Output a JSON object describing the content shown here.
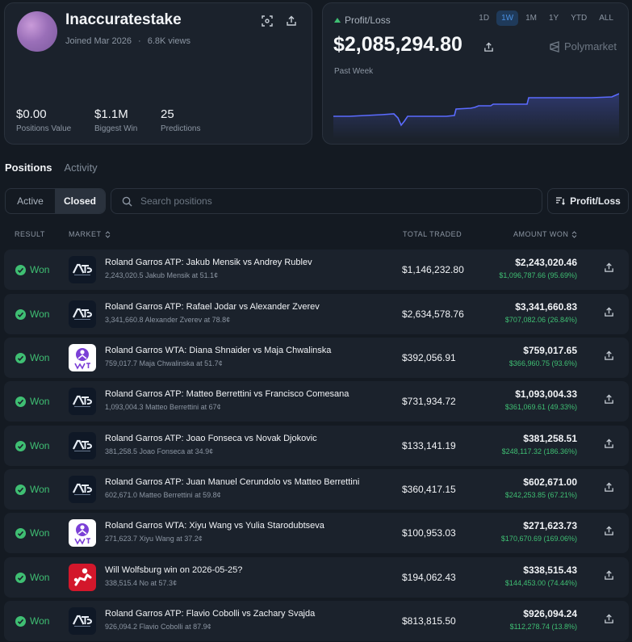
{
  "profile": {
    "username": "Inaccuratestake",
    "joined": "Joined Mar 2026",
    "separator": "·",
    "views": "6.8K views",
    "stats": [
      {
        "value": "$0.00",
        "label": "Positions Value"
      },
      {
        "value": "$1.1M",
        "label": "Biggest Win"
      },
      {
        "value": "25",
        "label": "Predictions"
      }
    ]
  },
  "pnl": {
    "label": "Profit/Loss",
    "value": "$2,085,294.80",
    "brand": "Polymarket",
    "period_label": "Past Week",
    "ranges": [
      "1D",
      "1W",
      "1M",
      "1Y",
      "YTD",
      "ALL"
    ],
    "active_range": "1W",
    "accent_color": "#5b6bff"
  },
  "tabs": {
    "positions": "Positions",
    "activity": "Activity"
  },
  "filter": {
    "active": "Active",
    "closed": "Closed"
  },
  "search": {
    "placeholder": "Search positions"
  },
  "sort": {
    "label": "Profit/Loss"
  },
  "columns": {
    "result": "RESULT",
    "market": "MARKET",
    "traded": "TOTAL TRADED",
    "won": "AMOUNT WON"
  },
  "positions": [
    {
      "result": "Won",
      "logo": "atp",
      "title": "Roland Garros ATP: Jakub Mensik vs Andrey Rublev",
      "detail": "2,243,020.5 Jakub Mensik at 51.1¢",
      "traded": "$1,146,232.80",
      "amount": "$2,243,020.46",
      "gain": "$1,096,787.66 (95.69%)"
    },
    {
      "result": "Won",
      "logo": "atp",
      "title": "Roland Garros ATP: Rafael Jodar vs Alexander Zverev",
      "detail": "3,341,660.8 Alexander Zverev at 78.8¢",
      "traded": "$2,634,578.76",
      "amount": "$3,341,660.83",
      "gain": "$707,082.06 (26.84%)"
    },
    {
      "result": "Won",
      "logo": "wta",
      "title": "Roland Garros WTA: Diana Shnaider vs Maja Chwalinska",
      "detail": "759,017.7 Maja Chwalinska at 51.7¢",
      "traded": "$392,056.91",
      "amount": "$759,017.65",
      "gain": "$366,960.75 (93.6%)"
    },
    {
      "result": "Won",
      "logo": "atp",
      "title": "Roland Garros ATP: Matteo Berrettini vs Francisco Comesana",
      "detail": "1,093,004.3 Matteo Berrettini at 67¢",
      "traded": "$731,934.72",
      "amount": "$1,093,004.33",
      "gain": "$361,069.61 (49.33%)"
    },
    {
      "result": "Won",
      "logo": "atp",
      "title": "Roland Garros ATP: Joao Fonseca vs Novak Djokovic",
      "detail": "381,258.5 Joao Fonseca at 34.9¢",
      "traded": "$133,141.19",
      "amount": "$381,258.51",
      "gain": "$248,117.32 (186.36%)"
    },
    {
      "result": "Won",
      "logo": "atp",
      "title": "Roland Garros ATP: Juan Manuel Cerundolo vs Matteo Berrettini",
      "detail": "602,671.0 Matteo Berrettini at 59.8¢",
      "traded": "$360,417.15",
      "amount": "$602,671.00",
      "gain": "$242,253.85 (67.21%)"
    },
    {
      "result": "Won",
      "logo": "wta",
      "title": "Roland Garros WTA: Xiyu Wang vs Yulia Starodubtseva",
      "detail": "271,623.7 Xiyu Wang at 37.2¢",
      "traded": "$100,953.03",
      "amount": "$271,623.73",
      "gain": "$170,670.69 (169.06%)"
    },
    {
      "result": "Won",
      "logo": "bund",
      "title": "Will Wolfsburg win on 2026-05-25?",
      "detail": "338,515.4 No at 57.3¢",
      "traded": "$194,062.43",
      "amount": "$338,515.43",
      "gain": "$144,453.00 (74.44%)"
    },
    {
      "result": "Won",
      "logo": "atp",
      "title": "Roland Garros ATP: Flavio Cobolli vs Zachary Svajda",
      "detail": "926,094.2 Flavio Cobolli at 87.9¢",
      "traded": "$813,815.50",
      "amount": "$926,094.24",
      "gain": "$112,278.74 (13.8%)"
    }
  ]
}
